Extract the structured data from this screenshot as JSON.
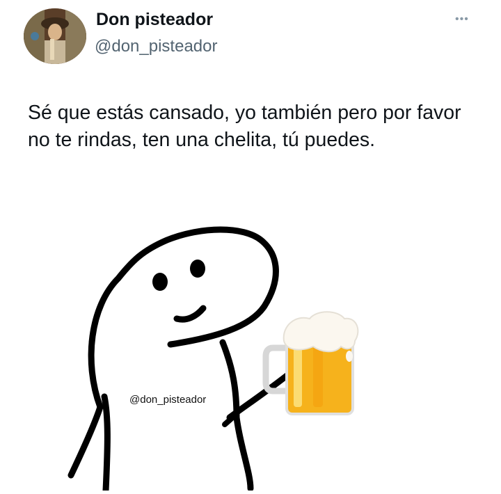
{
  "tweet": {
    "author_name": "Don pisteador",
    "author_handle": "@don_pisteador",
    "more_icon": "ellipsis-icon",
    "text": "Sé que estás cansado, yo también pero por favor no te rindas, ten una chelita, tú puedes.",
    "media": {
      "watermark": "@don_pisteador",
      "description_icons": [
        "stick-figure",
        "beer-mug-icon"
      ]
    }
  }
}
